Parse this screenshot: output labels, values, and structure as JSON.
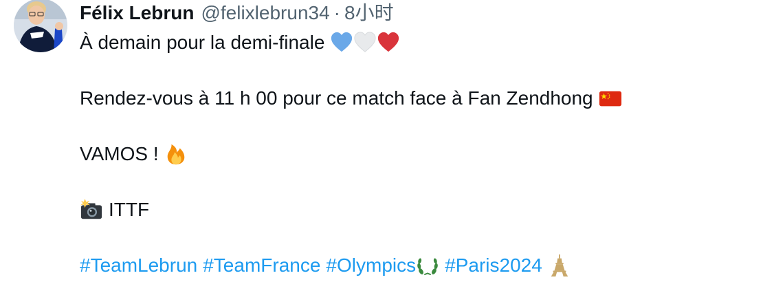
{
  "author": {
    "display_name": "Félix Lebrun",
    "handle": "@felixlebrun34",
    "separator": "·",
    "time": "8小时"
  },
  "tweet": {
    "line1": "À demain pour la demi-finale",
    "line2": "Rendez-vous à 11 h 00 pour ce match face à Fan Zendhong",
    "line3": "VAMOS !",
    "line4": "ITTF",
    "hashtags": [
      "#TeamLebrun",
      "#TeamFrance",
      "#Olympics",
      "#Paris2024"
    ]
  },
  "icons": {
    "blue_heart": "blue-heart-icon",
    "white_heart": "white-heart-icon",
    "red_heart": "red-heart-icon",
    "china_flag": "china-flag-icon",
    "fire": "fire-icon",
    "camera_flash": "camera-flash-icon",
    "olympic_wreath": "olympic-wreath-icon",
    "eiffel_tower": "eiffel-tower-icon"
  },
  "colors": {
    "text": "#0f1419",
    "secondary": "#536471",
    "link": "#1d9bf0"
  }
}
